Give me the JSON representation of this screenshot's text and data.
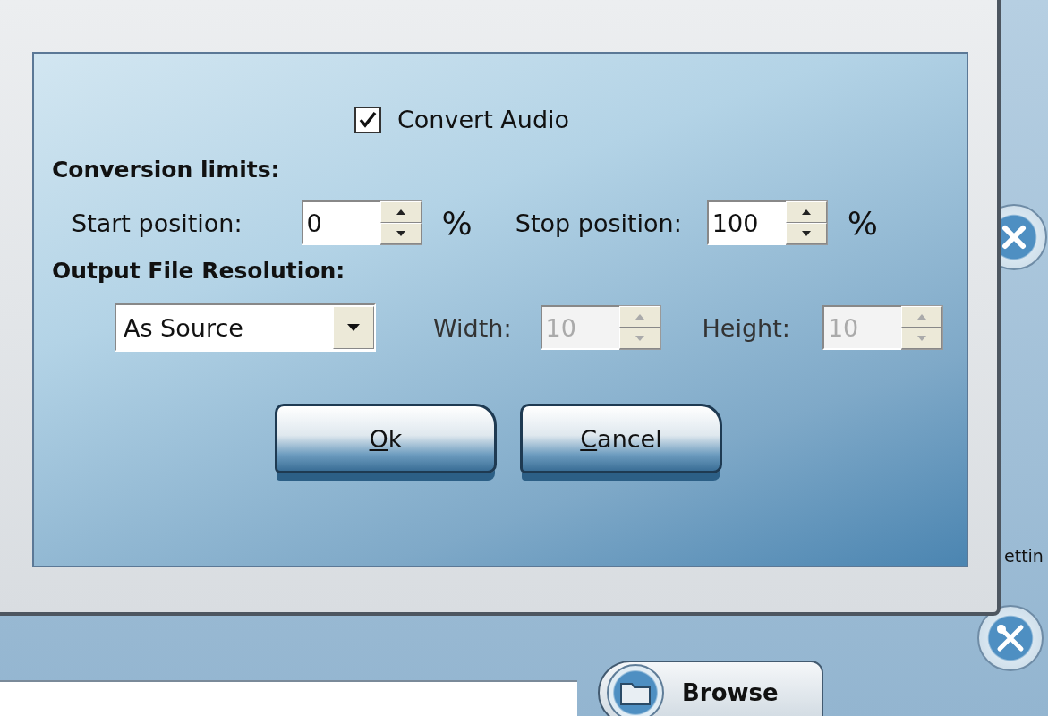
{
  "dialog": {
    "convert_audio": {
      "label": "Convert Audio",
      "checked": true
    },
    "conversion_limits": {
      "heading": "Conversion limits:",
      "fields": [
        {
          "label": "Start position:",
          "value": "0",
          "unit": "%",
          "disabled": false
        },
        {
          "label": "Stop position:",
          "value": "100",
          "unit": "%",
          "disabled": false
        }
      ]
    },
    "output_resolution": {
      "heading": "Output File Resolution:",
      "preset": "As Source",
      "fields": [
        {
          "label": "Width:",
          "value": "10",
          "disabled": true
        },
        {
          "label": "Height:",
          "value": "10",
          "disabled": true
        }
      ]
    },
    "buttons": [
      {
        "label": "Ok"
      },
      {
        "label": "Cancel"
      }
    ]
  },
  "background": {
    "side_label": "ettin",
    "browse_button": "Browse"
  }
}
